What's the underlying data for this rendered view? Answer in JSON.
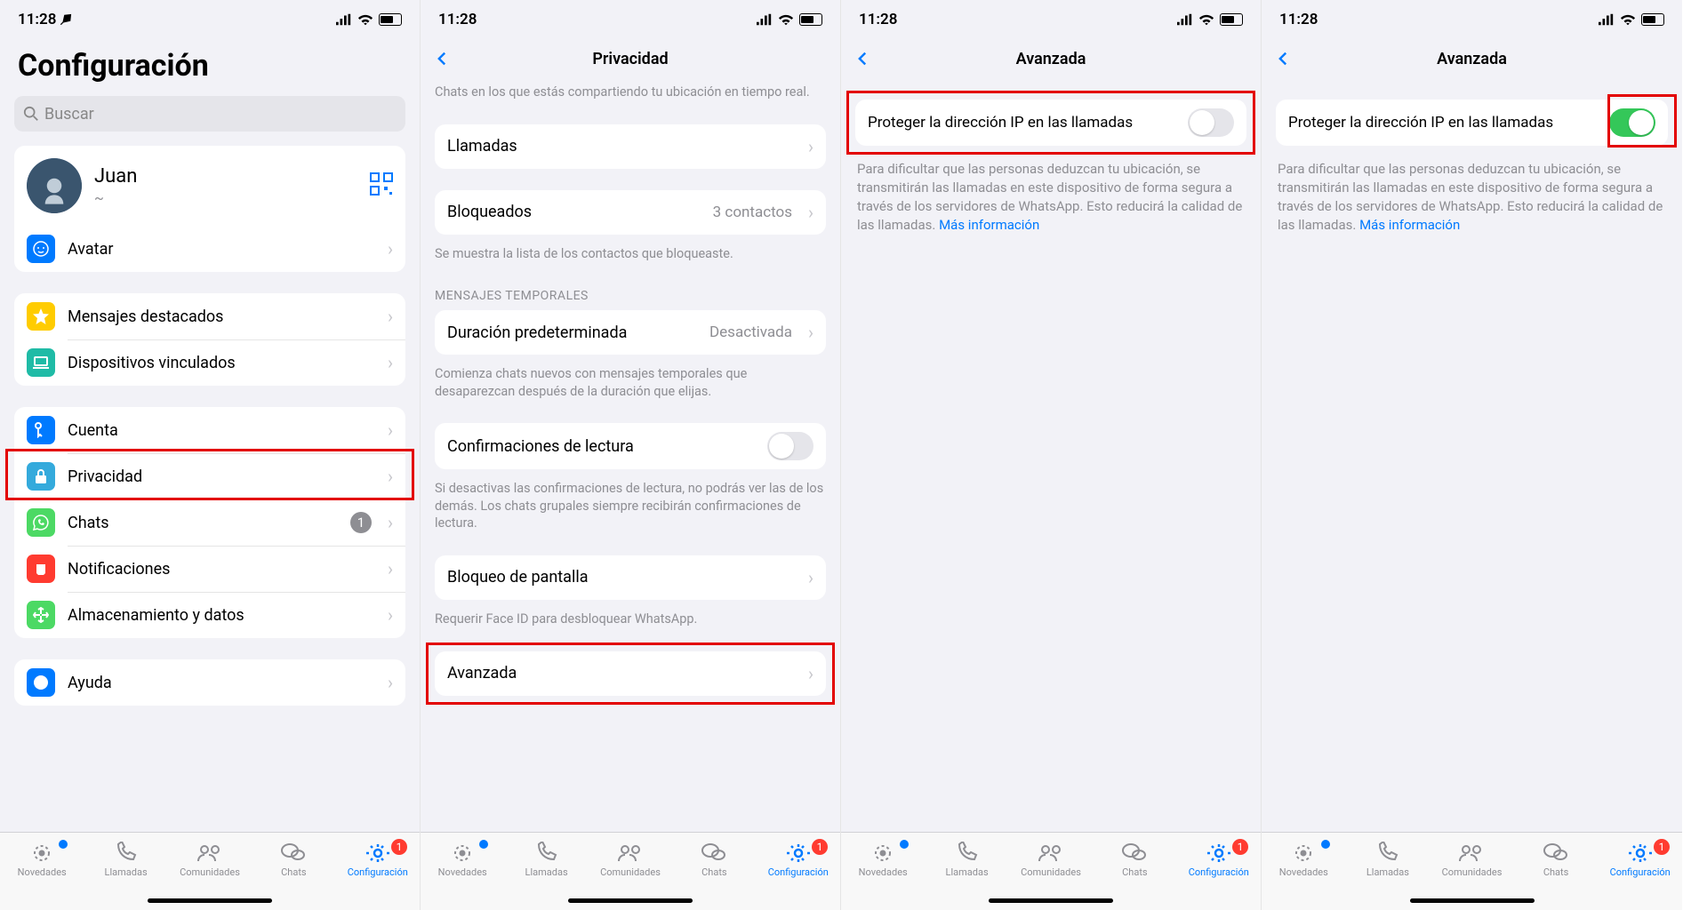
{
  "status": {
    "time": "11:28",
    "battery": "65"
  },
  "s1": {
    "title": "Configuración",
    "search_placeholder": "Buscar",
    "profile": {
      "name": "Juan",
      "subtitle": "~"
    },
    "avatar_label": "Avatar",
    "starred": "Mensajes destacados",
    "linked": "Dispositivos vinculados",
    "account": "Cuenta",
    "privacy": "Privacidad",
    "chats": "Chats",
    "chats_badge": "1",
    "notifications": "Notificaciones",
    "storage": "Almacenamiento y datos",
    "help": "Ayuda"
  },
  "s2": {
    "title": "Privacidad",
    "location_footer": "Chats en los que estás compartiendo tu ubicación en tiempo real.",
    "calls": "Llamadas",
    "blocked": "Bloqueados",
    "blocked_value": "3 contactos",
    "blocked_footer": "Se muestra la lista de los contactos que bloqueaste.",
    "temp_header": "MENSAJES TEMPORALES",
    "default_duration": "Duración predeterminada",
    "default_duration_value": "Desactivada",
    "temp_footer": "Comienza chats nuevos con mensajes temporales que desaparezcan después de la duración que elijas.",
    "read_receipts": "Confirmaciones de lectura",
    "read_footer": "Si desactivas las confirmaciones de lectura, no podrás ver las de los demás. Los chats grupales siempre recibirán confirmaciones de lectura.",
    "screen_lock": "Bloqueo de pantalla",
    "screen_footer": "Requerir Face ID para desbloquear WhatsApp.",
    "advanced": "Avanzada"
  },
  "s3": {
    "title": "Avanzada",
    "protect_ip": "Proteger la dirección IP en las llamadas",
    "desc": "Para dificultar que las personas deduzcan tu ubicación, se transmitirán las llamadas en este dispositivo de forma segura a través de los servidores de WhatsApp. Esto reducirá la calidad de las llamadas. ",
    "more": "Más información"
  },
  "tabs": {
    "updates": "Novedades",
    "calls": "Llamadas",
    "communities": "Comunidades",
    "chats": "Chats",
    "settings": "Configuración",
    "badge": "1"
  }
}
